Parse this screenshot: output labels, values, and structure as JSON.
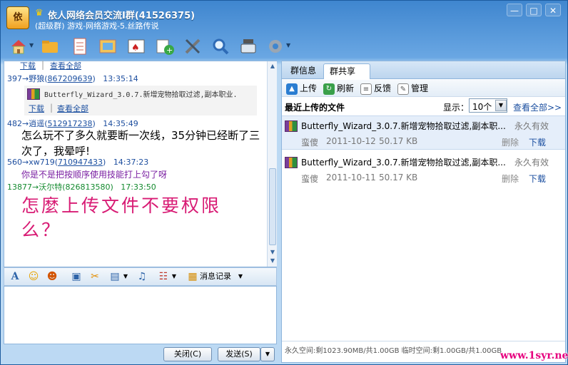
{
  "window": {
    "title": "依人网络会员交流Ⅰ群(41526375)",
    "subtitle": "(超级群) 游戏-网络游戏-5.丝路传说",
    "app_icon_text": "依",
    "controls": {
      "minimize": "—",
      "maximize": "□",
      "close": "✕"
    }
  },
  "toolbar": {
    "icons": [
      "home-icon",
      "folder-icon",
      "notes-icon",
      "album-icon",
      "poker-icon",
      "add-app-icon",
      "tools-icon",
      "search-icon",
      "settings-icon",
      "config-icon"
    ]
  },
  "chat": {
    "top_links": {
      "download": "下载",
      "view_all": "查看全部"
    },
    "messages": [
      {
        "id": "397",
        "name": "野狼",
        "qq": "867209639",
        "time": "13:35:14"
      },
      {
        "id": "482",
        "name": "逍遥",
        "qq": "512917238",
        "time": "14:35:49"
      },
      {
        "id": "560",
        "name": "xw719",
        "qq": "710947433",
        "time": "14:37:23"
      },
      {
        "id": "13877",
        "name": "沃尔特",
        "qq": "826813580",
        "time": "17:33:50"
      }
    ],
    "file_card": {
      "filename": "Butterfly_Wizard_3.0.7.新增宠物拾取过滤,副本职业.",
      "download": "下载",
      "view_all": "查看全部"
    },
    "texts": {
      "msg2": "怎么玩不了多久就要断一次线，35分钟已经断了三次了，我晕呼!",
      "msg3": "你是不是把按顺序使用技能打上勾了呀",
      "handwriting": "怎麼上传文件不要权限么？"
    },
    "arrow": "→"
  },
  "chat_toolbar": {
    "history": "消息记录"
  },
  "input": {
    "close_btn": "关闭(C)",
    "send_btn": "发送(S)"
  },
  "right": {
    "tabs": {
      "info": "群信息",
      "share": "群共享"
    },
    "share_toolbar": {
      "upload": "上传",
      "refresh": "刷新",
      "feedback": "反馈",
      "manage": "管理"
    },
    "recent_label": "最近上传的文件",
    "display_label": "显示：",
    "display_value": "10个",
    "view_all": "查看全部>>",
    "files": [
      {
        "name": "Butterfly_Wizard_3.0.7.新增宠物拾取过滤,副本职...",
        "validity": "永久有效",
        "uploader": "蛮傻",
        "date": "2011-10-12",
        "size": "50.17 KB",
        "delete": "删除",
        "download": "下载"
      },
      {
        "name": "Butterfly_Wizard_3.0.7.新增宠物拾取过滤,副本职...",
        "validity": "永久有效",
        "uploader": "蛮傻",
        "date": "2011-10-11",
        "size": "50.17 KB",
        "delete": "删除",
        "download": "下载"
      }
    ],
    "footer": "永久空间:剩1023.90MB/共1.00GB 临时空间:剩1.00GB/共1.00GB"
  },
  "watermark": "www.1syr.net"
}
